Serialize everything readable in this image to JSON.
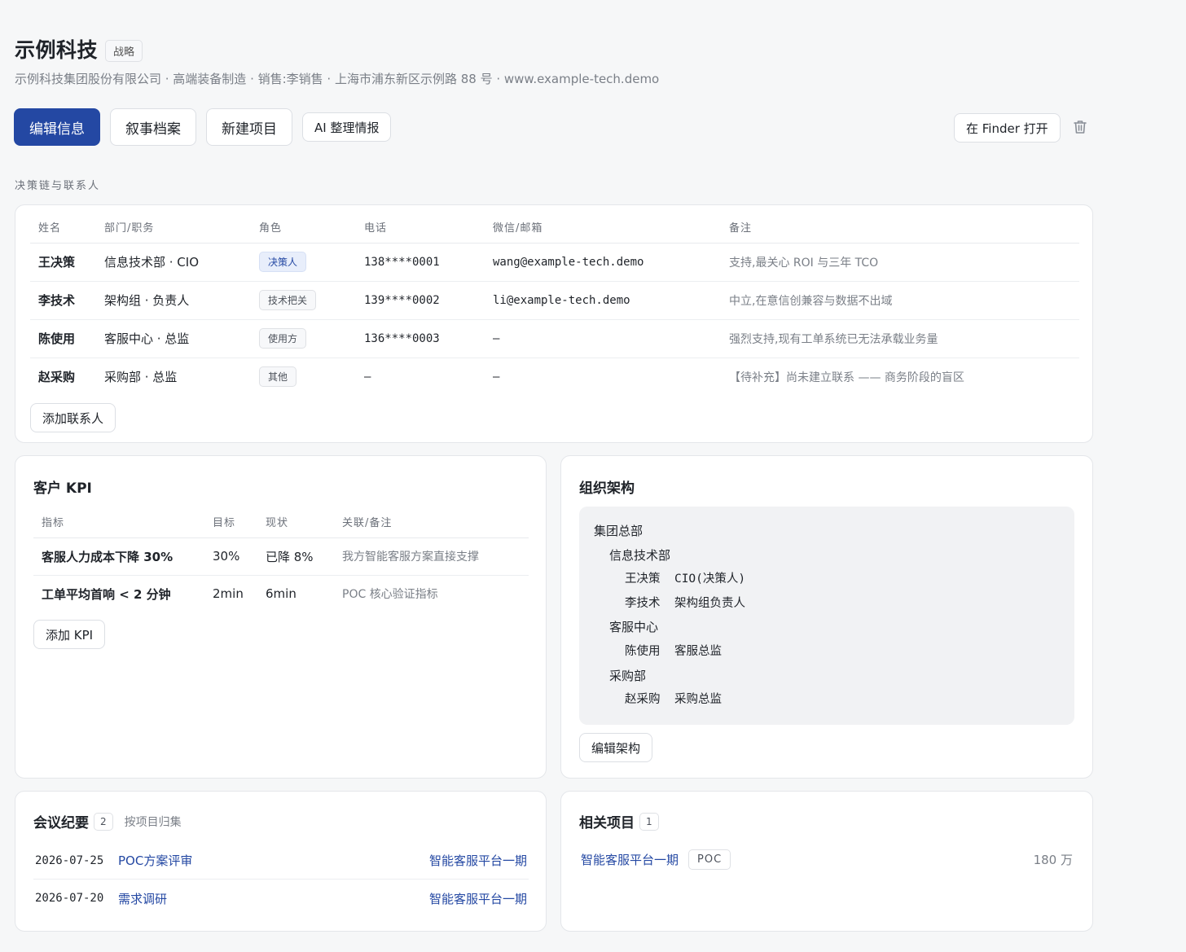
{
  "header": {
    "company_name": "示例科技",
    "tag": "战略",
    "subtitle": "示例科技集团股份有限公司 · 高端装备制造 · 销售:李销售 · 上海市浦东新区示例路 88 号 · www.example-tech.demo"
  },
  "toolbar": {
    "edit_info": "编辑信息",
    "narrative_archive": "叙事档案",
    "new_project": "新建项目",
    "ai_organize": "AI 整理情报",
    "open_in_finder": "在 Finder 打开",
    "delete_icon": "trash-icon"
  },
  "contacts": {
    "section_label": "决策链与联系人",
    "columns": [
      "姓名",
      "部门/职务",
      "角色",
      "电话",
      "微信/邮箱",
      "备注"
    ],
    "rows": [
      {
        "name": "王决策",
        "dept": "信息技术部 · CIO",
        "role": "决策人",
        "phone": "138****0001",
        "contact": "wang@example-tech.demo",
        "note": "支持,最关心 ROI 与三年 TCO"
      },
      {
        "name": "李技术",
        "dept": "架构组 · 负责人",
        "role": "技术把关",
        "phone": "139****0002",
        "contact": "li@example-tech.demo",
        "note": "中立,在意信创兼容与数据不出域"
      },
      {
        "name": "陈使用",
        "dept": "客服中心 · 总监",
        "role": "使用方",
        "phone": "136****0003",
        "contact": "—",
        "note": "强烈支持,现有工单系统已无法承载业务量"
      },
      {
        "name": "赵采购",
        "dept": "采购部 · 总监",
        "role": "其他",
        "phone": "—",
        "contact": "—",
        "note": "【待补充】尚未建立联系 —— 商务阶段的盲区"
      }
    ],
    "add_button": "添加联系人",
    "colors": {
      "decider_chip_bg": "#e8eefb",
      "decider_chip_text": "#2448a3"
    }
  },
  "kpi": {
    "title": "客户 KPI",
    "columns": [
      "指标",
      "目标",
      "现状",
      "关联/备注"
    ],
    "rows": [
      {
        "metric": "客服人力成本下降 30%",
        "target": "30%",
        "current": "已降 8%",
        "note": "我方智能客服方案直接支撑"
      },
      {
        "metric": "工单平均首响 < 2 分钟",
        "target": "2min",
        "current": "6min",
        "note": "POC 核心验证指标"
      }
    ],
    "add_button": "添加 KPI"
  },
  "org": {
    "title": "组织架构",
    "lines": [
      {
        "level": 0,
        "text": "集团总部"
      },
      {
        "level": 1,
        "text": "信息技术部"
      },
      {
        "level": 2,
        "text": "王决策  CIO(决策人)"
      },
      {
        "level": 2,
        "text": "李技术  架构组负责人"
      },
      {
        "level": 1,
        "text": "客服中心"
      },
      {
        "level": 2,
        "text": "陈使用  客服总监"
      },
      {
        "level": 1,
        "text": "采购部"
      },
      {
        "level": 2,
        "text": "赵采购  采购总监"
      }
    ],
    "edit_button": "编辑架构"
  },
  "meetings": {
    "title": "会议纪要",
    "count": "2",
    "group_by": "按项目归集",
    "items": [
      {
        "date": "2026-07-25",
        "title": "POC方案评审",
        "project": "智能客服平台一期"
      },
      {
        "date": "2026-07-20",
        "title": "需求调研",
        "project": "智能客服平台一期"
      }
    ]
  },
  "projects": {
    "title": "相关项目",
    "count": "1",
    "items": [
      {
        "name": "智能客服平台一期",
        "stage": "POC",
        "amount": "180 万"
      }
    ]
  },
  "theme": {
    "accent": "#2448a3",
    "background": "#f6f7f8"
  }
}
